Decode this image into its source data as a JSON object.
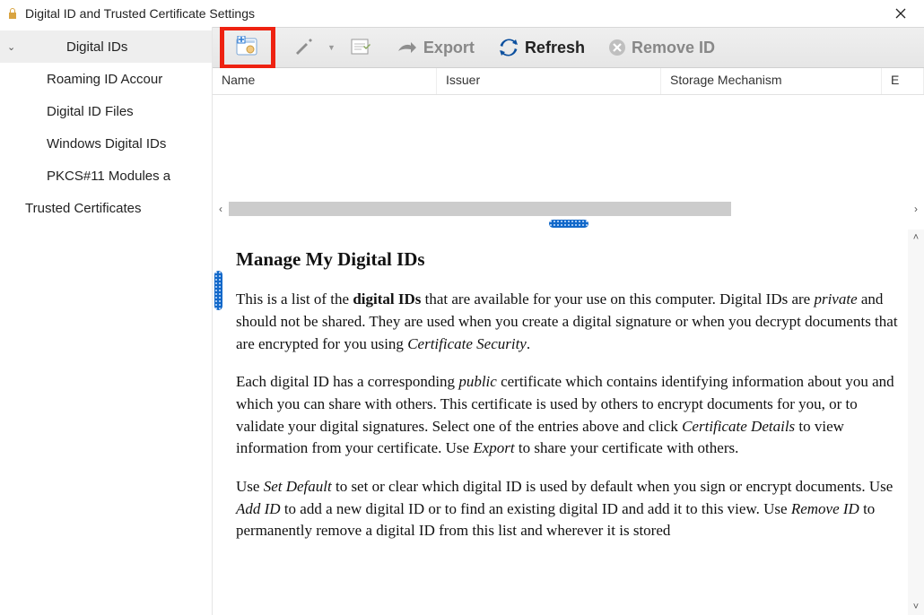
{
  "window": {
    "title": "Digital ID and Trusted Certificate Settings"
  },
  "sidebar": {
    "root_expanded_icon": "⌄",
    "items": [
      {
        "label": "Digital IDs",
        "selected": true,
        "top": true
      },
      {
        "label": "Roaming ID Accour"
      },
      {
        "label": "Digital ID Files"
      },
      {
        "label": "Windows Digital IDs"
      },
      {
        "label": "PKCS#11 Modules a"
      },
      {
        "label": "Trusted Certificates",
        "top": true
      }
    ]
  },
  "toolbar": {
    "export_label": "Export",
    "refresh_label": "Refresh",
    "remove_label": "Remove ID"
  },
  "table": {
    "columns": {
      "name": "Name",
      "issuer": "Issuer",
      "storage": "Storage Mechanism",
      "extra": "E"
    }
  },
  "help": {
    "heading": "Manage My Digital IDs",
    "p1_a": "This is a list of the ",
    "p1_b": "digital IDs",
    "p1_c": " that are available for your use on this computer. Digital IDs are ",
    "p1_d": "private",
    "p1_e": " and should not be shared. They are used when you create a digital signature or when you decrypt documents that are encrypted for you using ",
    "p1_f": "Certificate Security",
    "p1_g": ".",
    "p2_a": "Each digital ID has a corresponding ",
    "p2_b": "public",
    "p2_c": " certificate which contains identifying information about you and which you can share with others. This certificate is used by others to encrypt documents for you, or to validate your digital signatures. Select one of the entries above and click ",
    "p2_d": "Certificate Details",
    "p2_e": " to view information from your certificate. Use ",
    "p2_f": "Export",
    "p2_g": " to share your certificate with others.",
    "p3_a": "Use ",
    "p3_b": "Set Default",
    "p3_c": " to set or clear which digital ID is used by default when you sign or encrypt documents. Use ",
    "p3_d": "Add ID",
    "p3_e": " to add a new digital ID or to find an existing digital ID and add it to this view. Use ",
    "p3_f": "Remove ID",
    "p3_g": " to permanently remove a digital ID from this list and wherever it is stored"
  }
}
